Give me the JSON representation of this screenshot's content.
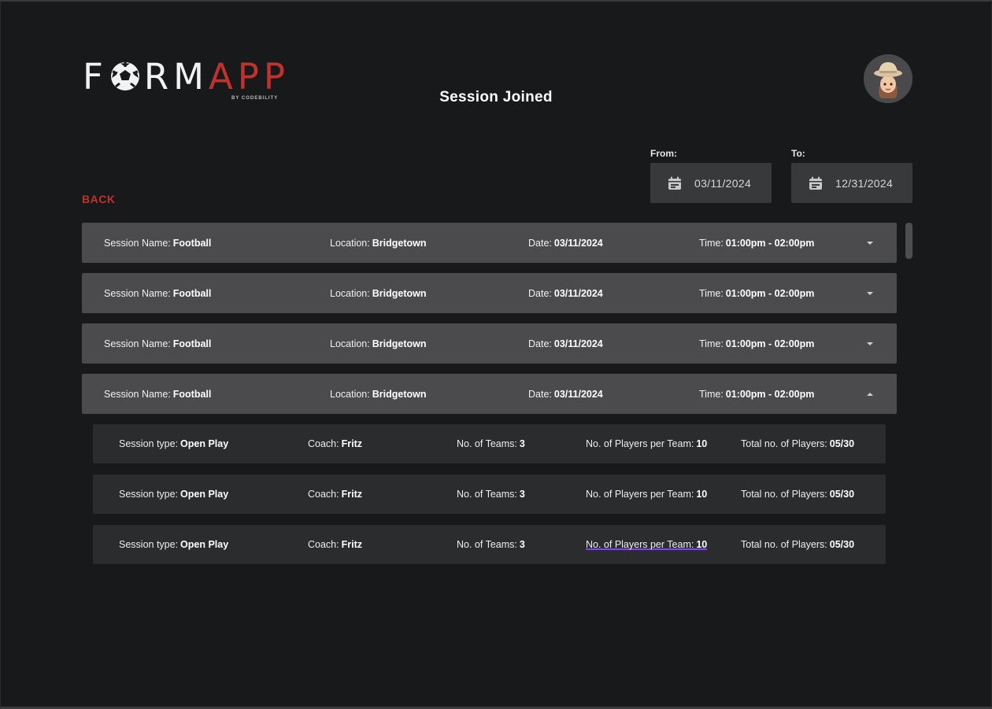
{
  "brand": {
    "logo_left": "F",
    "logo_mid": "RM",
    "logo_right": "APP",
    "logo_sub": "BY CODEBILITY"
  },
  "page_title": "Session Joined",
  "filters": {
    "from_label": "From:",
    "from_value": "03/11/2024",
    "to_label": "To:",
    "to_value": "12/31/2024"
  },
  "back_label": "BACK",
  "sessions": [
    {
      "name_label": "Session Name:",
      "name": "Football",
      "location_label": "Location:",
      "location": "Bridgetown",
      "date_label": "Date:",
      "date": "03/11/2024",
      "time_label": "Time:",
      "time": "01:00pm - 02:00pm",
      "expanded": false
    },
    {
      "name_label": "Session Name:",
      "name": "Football",
      "location_label": "Location:",
      "location": "Bridgetown",
      "date_label": "Date:",
      "date": "03/11/2024",
      "time_label": "Time:",
      "time": "01:00pm - 02:00pm",
      "expanded": false
    },
    {
      "name_label": "Session Name:",
      "name": "Football",
      "location_label": "Location:",
      "location": "Bridgetown",
      "date_label": "Date:",
      "date": "03/11/2024",
      "time_label": "Time:",
      "time": "01:00pm - 02:00pm",
      "expanded": false
    },
    {
      "name_label": "Session Name:",
      "name": "Football",
      "location_label": "Location:",
      "location": "Bridgetown",
      "date_label": "Date:",
      "date": "03/11/2024",
      "time_label": "Time:",
      "time": "01:00pm - 02:00pm",
      "expanded": true
    }
  ],
  "details": [
    {
      "type_label": "Session type:",
      "type": "Open Play",
      "coach_label": "Coach:",
      "coach": "Fritz",
      "teams_label": "No. of Teams:",
      "teams": "3",
      "ppt_label": "No. of Players per Team:",
      "ppt": "10",
      "total_label": "Total no. of Players:",
      "total": "05/30"
    },
    {
      "type_label": "Session type:",
      "type": "Open Play",
      "coach_label": "Coach:",
      "coach": "Fritz",
      "teams_label": "No. of Teams:",
      "teams": "3",
      "ppt_label": "No. of Players per Team:",
      "ppt": "10",
      "total_label": "Total no. of Players:",
      "total": "05/30"
    },
    {
      "type_label": "Session type:",
      "type": "Open Play",
      "coach_label": "Coach:",
      "coach": "Fritz",
      "teams_label": "No. of Teams:",
      "teams": "3",
      "ppt_label": "No. of Players per Team:",
      "ppt": "10",
      "total_label": "Total no. of Players:",
      "total": "05/30"
    }
  ],
  "colors": {
    "accent": "#c0322b",
    "background": "#18191b",
    "row": "#4b4b4d",
    "detail_row": "#2b2c2e",
    "highlight": "#8a3ffc"
  },
  "icons": {
    "calendar": "calendar-icon",
    "expand": "chevron-down-icon",
    "collapse": "chevron-up-icon",
    "avatar": "avatar",
    "logo_ball": "soccer-ball-icon"
  }
}
